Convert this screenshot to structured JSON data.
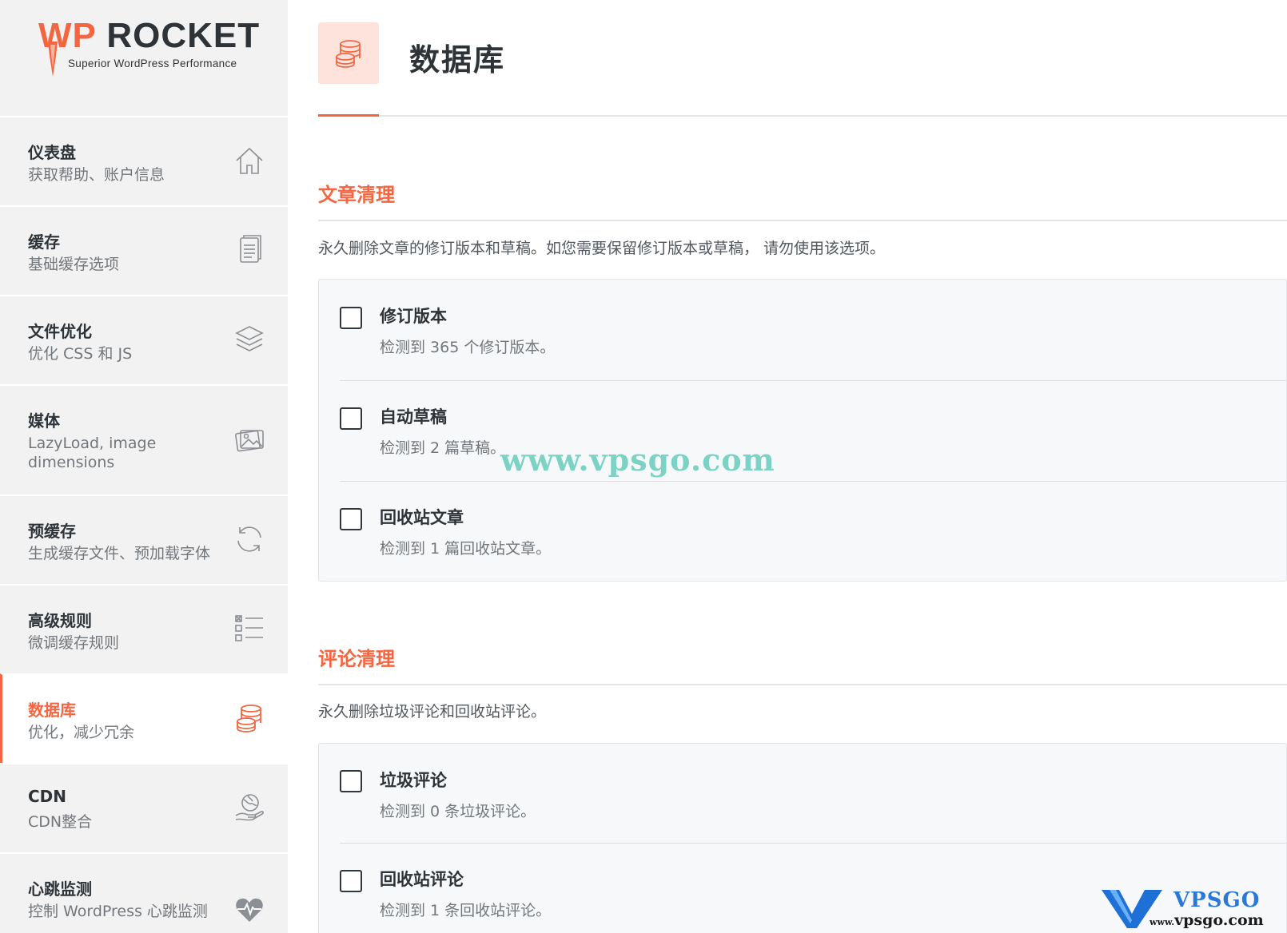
{
  "brand": {
    "logo_wp": "WP",
    "logo_rocket": " ROCKET",
    "tagline": "Superior WordPress Performance",
    "accent_color": "#f56640"
  },
  "sidebar": {
    "items": [
      {
        "title": "仪表盘",
        "subtitle": "获取帮助、账户信息",
        "icon": "home-icon"
      },
      {
        "title": "缓存",
        "subtitle": "基础缓存选项",
        "icon": "document-icon"
      },
      {
        "title": "文件优化",
        "subtitle": "优化 CSS 和 JS",
        "icon": "layers-icon"
      },
      {
        "title": "媒体",
        "subtitle": "LazyLoad, image dimensions",
        "icon": "image-icon"
      },
      {
        "title": "预缓存",
        "subtitle": "生成缓存文件、预加载字体",
        "icon": "refresh-icon"
      },
      {
        "title": "高级规则",
        "subtitle": "微调缓存规则",
        "icon": "list-icon"
      },
      {
        "title": "数据库",
        "subtitle": "优化，减少冗余",
        "icon": "database-icon",
        "active": true
      },
      {
        "title": "CDN",
        "subtitle": "CDN整合",
        "icon": "globe-hand-icon"
      },
      {
        "title": "心跳监测",
        "subtitle": "控制 WordPress 心跳监测",
        "icon": "heartbeat-icon"
      }
    ]
  },
  "page": {
    "title": "数据库",
    "icon": "database-icon"
  },
  "sections": [
    {
      "title": "文章清理",
      "description": "永久删除文章的修订版本和草稿。如您需要保留修订版本或草稿， 请勿使用该选项。",
      "options": [
        {
          "label": "修订版本",
          "detail": "检测到 365 个修订版本。",
          "checked": false
        },
        {
          "label": "自动草稿",
          "detail": "检测到 2 篇草稿。",
          "checked": false
        },
        {
          "label": "回收站文章",
          "detail": "检测到 1 篇回收站文章。",
          "checked": false
        }
      ]
    },
    {
      "title": "评论清理",
      "description": "永久删除垃圾评论和回收站评论。",
      "options": [
        {
          "label": "垃圾评论",
          "detail": "检测到 0 条垃圾评论。",
          "checked": false
        },
        {
          "label": "回收站评论",
          "detail": "检测到 1 条回收站评论。",
          "checked": false
        }
      ]
    }
  ],
  "watermark": {
    "url_text": "www.vpsgo.com",
    "logo_top": "VPSGO",
    "logo_small": "www.",
    "logo_bottom": "vpsgo.com"
  }
}
